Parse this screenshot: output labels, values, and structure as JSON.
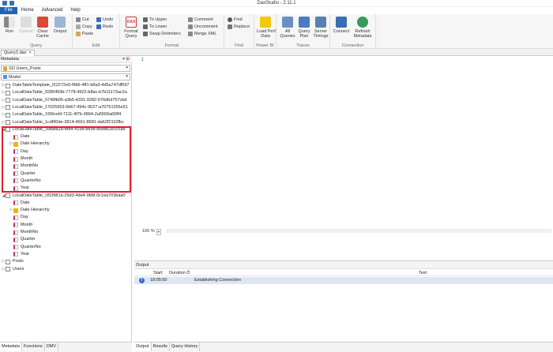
{
  "window": {
    "title": "DaxStudio - 2.11.1"
  },
  "menu": {
    "tabs": [
      "File",
      "Home",
      "Advanced",
      "Help"
    ]
  },
  "ribbon": {
    "run": "Run",
    "cancel": "Cancel",
    "clear_cache": "Clear\nCache",
    "output": "Output",
    "query_group": "Query",
    "cut": "Cut",
    "copy": "Copy",
    "paste": "Paste",
    "undo": "Undo",
    "redo": "Redo",
    "edit_group": "Edit",
    "format_query": "Format\nQuery",
    "to_upper": "To Upper",
    "to_lower": "To Lower",
    "swap_delimiters": "Swap Delimiters",
    "comment": "Comment",
    "uncomment": "Uncomment",
    "merge_xml": "Merge XML",
    "format_group": "Format",
    "find": "Find",
    "replace": "Replace",
    "find_group": "Find",
    "load_perf_data": "Load Perf\nData",
    "powerbi_group": "Power BI",
    "all_queries": "All\nQueries",
    "query_plan": "Query\nPlan",
    "server_timings": "Server\nTimings",
    "traces_group": "Traces",
    "connect": "Connect",
    "refresh_metadata": "Refresh\nMetadata",
    "connection_group": "Connection"
  },
  "doc_tab": {
    "label": "Query1.dax",
    "close": "×"
  },
  "metadata": {
    "header": "Metadata",
    "pin": "▾ ⊞",
    "database": "SO Users_Posts",
    "model": "Model",
    "tree": [
      {
        "label": "DateTableTemplate_f22272e9-f9b6-4ff1-b8a3-4d5a747df597",
        "kind": "table",
        "expander": "▷",
        "indent": 0
      },
      {
        "label": "LocalDateTable_0285459b-7778-4922-b8ac-b7b11173ac2a",
        "kind": "table",
        "expander": "▷",
        "indent": 0
      },
      {
        "label": "LocalDateTable_0749fb05-a3b5-4331-9282-576d6d757cbd",
        "kind": "table",
        "expander": "▷",
        "indent": 0
      },
      {
        "label": "LocalDateTable_17025953-0b67-494c-9527-a70751355e51",
        "kind": "table",
        "expander": "▷",
        "indent": 0
      },
      {
        "label": "LocalDateTable_195fcebf-7111-4f7b-9894-2a5569a66ff4",
        "kind": "table",
        "expander": "▷",
        "indent": 0
      },
      {
        "label": "LocalDateTable_1cdf90de-3814-4661-8681-da62f2102fbc",
        "kind": "table",
        "expander": "▷",
        "indent": 0
      },
      {
        "label": "LocalDateTable_39bafa1b-fbb4-419d-8e98-86dd6281ccab",
        "kind": "table",
        "expander": "◢",
        "indent": 0
      },
      {
        "label": "Date",
        "kind": "col",
        "expander": "",
        "indent": 1
      },
      {
        "label": "Date Hierarchy",
        "kind": "hier",
        "expander": "▷",
        "indent": 1
      },
      {
        "label": "Day",
        "kind": "col",
        "expander": "",
        "indent": 1
      },
      {
        "label": "Month",
        "kind": "col",
        "expander": "",
        "indent": 1
      },
      {
        "label": "MonthNo",
        "kind": "col",
        "expander": "",
        "indent": 1
      },
      {
        "label": "Quarter",
        "kind": "col",
        "expander": "",
        "indent": 1
      },
      {
        "label": "QuarterNo",
        "kind": "col",
        "expander": "",
        "indent": 1
      },
      {
        "label": "Year",
        "kind": "col",
        "expander": "",
        "indent": 1
      },
      {
        "label": "LocalDateTable_c81f981a-25d3-4de4-9fd8-0c1ea703baa0",
        "kind": "table",
        "expander": "◢",
        "indent": 0
      },
      {
        "label": "Date",
        "kind": "col",
        "expander": "",
        "indent": 1
      },
      {
        "label": "Date Hierarchy",
        "kind": "hier",
        "expander": "▷",
        "indent": 1
      },
      {
        "label": "Day",
        "kind": "col",
        "expander": "",
        "indent": 1
      },
      {
        "label": "Month",
        "kind": "col",
        "expander": "",
        "indent": 1
      },
      {
        "label": "MonthNo",
        "kind": "col",
        "expander": "",
        "indent": 1
      },
      {
        "label": "Quarter",
        "kind": "col",
        "expander": "",
        "indent": 1
      },
      {
        "label": "QuarterNo",
        "kind": "col",
        "expander": "",
        "indent": 1
      },
      {
        "label": "Year",
        "kind": "col",
        "expander": "",
        "indent": 1
      },
      {
        "label": "Posts",
        "kind": "table",
        "expander": "▷",
        "indent": 0
      },
      {
        "label": "Users",
        "kind": "table",
        "expander": "▷",
        "indent": 0
      }
    ],
    "bottom_tabs": [
      "Metadata",
      "Functions",
      "DMV"
    ]
  },
  "editor": {
    "line_number": "1",
    "zoom": "100 %",
    "zoom_dropdown": "▾"
  },
  "output": {
    "header": "Output",
    "columns": {
      "start": "Start",
      "duration": "Duration",
      "duration_icon": "⏱",
      "text": "Text"
    },
    "rows": [
      {
        "icon": "i",
        "start": "18:05:50",
        "duration": "",
        "text": "Establishing Connection"
      }
    ],
    "bottom_tabs": [
      "Output",
      "Results",
      "Query History"
    ]
  },
  "colors": {
    "file_tab": "#1e64b4",
    "highlight_border": "#e0202a",
    "selected_row": "#dde6f3"
  }
}
